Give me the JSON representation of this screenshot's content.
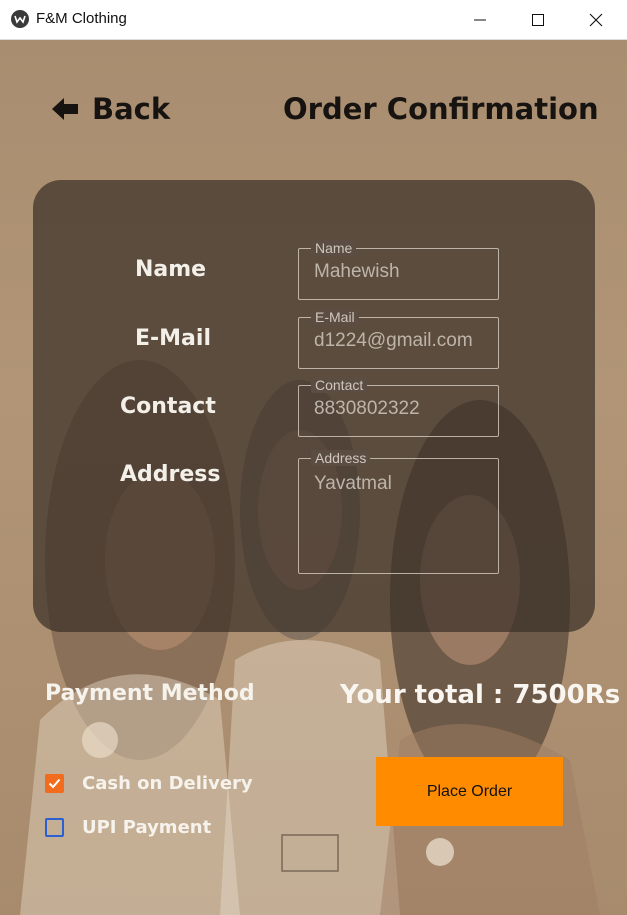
{
  "window": {
    "title": "F&M Clothing",
    "app_icon": "app-logo-icon",
    "controls": [
      "minimize-icon",
      "maximize-icon",
      "close-icon"
    ]
  },
  "header": {
    "back_label": "Back",
    "back_icon": "arrow-left-icon",
    "title": "Order Confirmation"
  },
  "form": {
    "name": {
      "label": "Name",
      "legend": "Name",
      "value": "Mahewish"
    },
    "email": {
      "label": "E-Mail",
      "legend": "E-Mail",
      "value": "d1224@gmail.com"
    },
    "contact": {
      "label": "Contact",
      "legend": "Contact",
      "value": "8830802322"
    },
    "address": {
      "label": "Address",
      "legend": "Address",
      "value": "Yavatmal"
    }
  },
  "payment": {
    "title": "Payment Method",
    "options": [
      {
        "label": "Cash on Delivery",
        "checked": true
      },
      {
        "label": "UPI Payment",
        "checked": false
      }
    ]
  },
  "total_text": "Your total : 7500Rs",
  "place_order_label": "Place Order",
  "colors": {
    "accent": "#ff8c00",
    "checkbox_checked": "#f36b1c",
    "checkbox_unchecked": "#2b5fd4",
    "card_overlay": "#3c3028"
  }
}
